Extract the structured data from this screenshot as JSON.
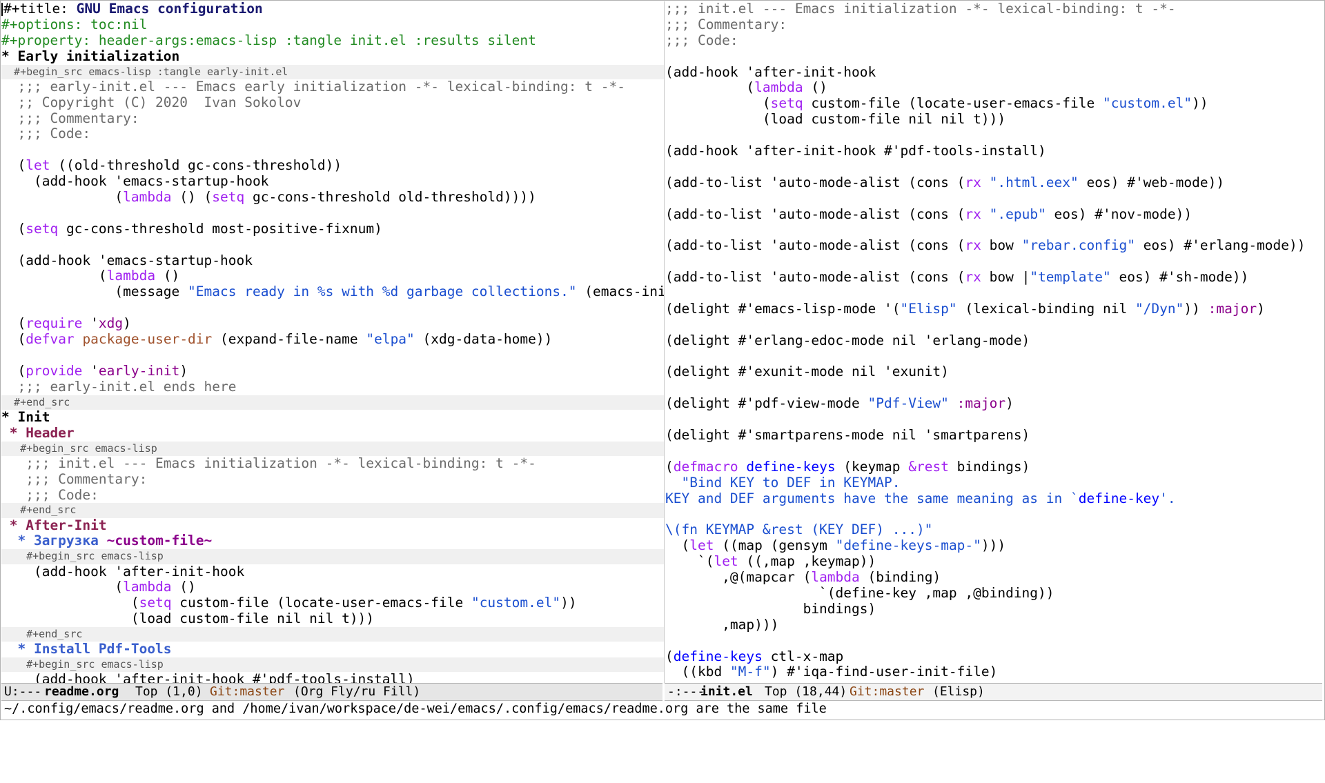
{
  "left_buffer": {
    "lines": [
      {
        "cls": "",
        "segs": [
          [
            "kw-title",
            "#+title: "
          ],
          [
            "t-title",
            "GNU Emacs configuration"
          ]
        ],
        "cursor": true
      },
      {
        "cls": "meta",
        "segs": [
          [
            "meta",
            "#+options: toc:nil"
          ]
        ]
      },
      {
        "cls": "meta",
        "segs": [
          [
            "meta",
            "#+property: header-args:emacs-lisp :tangle init.el :results silent"
          ]
        ]
      },
      {
        "cls": "h1",
        "segs": [
          [
            "",
            "* Early initialization"
          ]
        ]
      },
      {
        "cls": "small",
        "segs": [
          [
            "",
            "  #+begin_src emacs-lisp :tangle early-init.el"
          ]
        ]
      },
      {
        "cls": "",
        "segs": [
          [
            "cm",
            "  ;;; early-init.el --- Emacs early initialization -*- lexical-binding: t -*-"
          ]
        ]
      },
      {
        "cls": "",
        "segs": [
          [
            "cm",
            "  ;; Copyright (C) 2020  Ivan Sokolov"
          ]
        ]
      },
      {
        "cls": "",
        "segs": [
          [
            "cm",
            "  ;;; Commentary:"
          ]
        ]
      },
      {
        "cls": "",
        "segs": [
          [
            "cm",
            "  ;;; Code:"
          ]
        ]
      },
      {
        "cls": "",
        "segs": [
          [
            "",
            ""
          ]
        ]
      },
      {
        "cls": "",
        "segs": [
          [
            "",
            "  ("
          ],
          [
            "kw",
            "let"
          ],
          [
            "",
            " ((old-threshold gc-cons-threshold))"
          ]
        ]
      },
      {
        "cls": "",
        "segs": [
          [
            "",
            "    (add-hook 'emacs-startup-hook"
          ]
        ]
      },
      {
        "cls": "",
        "segs": [
          [
            "",
            "              ("
          ],
          [
            "kw",
            "lambda"
          ],
          [
            "",
            " () ("
          ],
          [
            "kw",
            "setq"
          ],
          [
            "",
            " gc-cons-threshold old-threshold))))"
          ]
        ]
      },
      {
        "cls": "",
        "segs": [
          [
            "",
            ""
          ]
        ]
      },
      {
        "cls": "",
        "segs": [
          [
            "",
            "  ("
          ],
          [
            "kw",
            "setq"
          ],
          [
            "",
            " gc-cons-threshold most-positive-fixnum)"
          ]
        ]
      },
      {
        "cls": "",
        "segs": [
          [
            "",
            ""
          ]
        ]
      },
      {
        "cls": "",
        "segs": [
          [
            "",
            "  (add-hook 'emacs-startup-hook"
          ]
        ]
      },
      {
        "cls": "",
        "segs": [
          [
            "",
            "            ("
          ],
          [
            "kw",
            "lambda"
          ],
          [
            "",
            " ()"
          ]
        ]
      },
      {
        "cls": "",
        "segs": [
          [
            "",
            "              (message "
          ],
          [
            "str",
            "\"Emacs ready in %s with %d garbage collections.\""
          ],
          [
            "",
            " (emacs-init-ti"
          ]
        ]
      },
      {
        "cls": "",
        "segs": [
          [
            "",
            ""
          ]
        ]
      },
      {
        "cls": "",
        "segs": [
          [
            "",
            "  ("
          ],
          [
            "kw",
            "require"
          ],
          [
            "",
            " '"
          ],
          [
            "kwd",
            "xdg"
          ],
          [
            "",
            ")"
          ]
        ]
      },
      {
        "cls": "",
        "segs": [
          [
            "",
            "  ("
          ],
          [
            "kw",
            "defvar"
          ],
          [
            "",
            " "
          ],
          [
            "var",
            "package-user-dir"
          ],
          [
            "",
            " (expand-file-name "
          ],
          [
            "str",
            "\"elpa\""
          ],
          [
            "",
            " (xdg-data-home))"
          ]
        ]
      },
      {
        "cls": "",
        "segs": [
          [
            "",
            ""
          ]
        ]
      },
      {
        "cls": "",
        "segs": [
          [
            "",
            "  ("
          ],
          [
            "kw",
            "provide"
          ],
          [
            "",
            " '"
          ],
          [
            "kwd",
            "early-init"
          ],
          [
            "",
            ")"
          ]
        ]
      },
      {
        "cls": "",
        "segs": [
          [
            "cm",
            "  ;;; early-init.el ends here"
          ]
        ]
      },
      {
        "cls": "small",
        "segs": [
          [
            "",
            "  #+end_src"
          ]
        ]
      },
      {
        "cls": "h1",
        "segs": [
          [
            "",
            "* Init"
          ]
        ]
      },
      {
        "cls": "h2",
        "segs": [
          [
            "",
            " * Header"
          ]
        ]
      },
      {
        "cls": "small",
        "segs": [
          [
            "",
            "   #+begin_src emacs-lisp"
          ]
        ]
      },
      {
        "cls": "",
        "segs": [
          [
            "cm",
            "   ;;; init.el --- Emacs initialization -*- lexical-binding: t -*-"
          ]
        ]
      },
      {
        "cls": "",
        "segs": [
          [
            "cm",
            "   ;;; Commentary:"
          ]
        ]
      },
      {
        "cls": "",
        "segs": [
          [
            "cm",
            "   ;;; Code:"
          ]
        ]
      },
      {
        "cls": "small",
        "segs": [
          [
            "",
            "   #+end_src"
          ]
        ]
      },
      {
        "cls": "h2",
        "segs": [
          [
            "",
            " * After-Init"
          ]
        ]
      },
      {
        "cls": "h3",
        "segs": [
          [
            "",
            "  * Загрузка "
          ],
          [
            "kwd",
            "~custom-file~"
          ]
        ]
      },
      {
        "cls": "small",
        "segs": [
          [
            "",
            "    #+begin_src emacs-lisp"
          ]
        ]
      },
      {
        "cls": "",
        "segs": [
          [
            "",
            "    (add-hook 'after-init-hook"
          ]
        ]
      },
      {
        "cls": "",
        "segs": [
          [
            "",
            "              ("
          ],
          [
            "kw",
            "lambda"
          ],
          [
            "",
            " ()"
          ]
        ]
      },
      {
        "cls": "",
        "segs": [
          [
            "",
            "                ("
          ],
          [
            "kw",
            "setq"
          ],
          [
            "",
            " custom-file (locate-user-emacs-file "
          ],
          [
            "str",
            "\"custom.el\""
          ],
          [
            "",
            "))"
          ]
        ]
      },
      {
        "cls": "",
        "segs": [
          [
            "",
            "                (load custom-file nil nil t)))"
          ]
        ]
      },
      {
        "cls": "small",
        "segs": [
          [
            "",
            "    #+end_src"
          ]
        ]
      },
      {
        "cls": "h3",
        "segs": [
          [
            "",
            "  * Install Pdf-Tools"
          ]
        ]
      },
      {
        "cls": "small",
        "segs": [
          [
            "",
            "    #+begin_src emacs-lisp"
          ]
        ]
      },
      {
        "cls": "",
        "segs": [
          [
            "",
            "    (add-hook 'after-init-hook #'pdf-tools-install)"
          ]
        ]
      }
    ]
  },
  "right_buffer": {
    "lines": [
      {
        "cls": "",
        "segs": [
          [
            "cm",
            ";;; init.el --- Emacs initialization -*- lexical-binding: t -*-"
          ]
        ]
      },
      {
        "cls": "",
        "segs": [
          [
            "cm",
            ";;; Commentary:"
          ]
        ]
      },
      {
        "cls": "",
        "segs": [
          [
            "cm",
            ";;; Code:"
          ]
        ]
      },
      {
        "cls": "",
        "segs": [
          [
            "",
            ""
          ]
        ]
      },
      {
        "cls": "",
        "segs": [
          [
            "",
            "(add-hook 'after-init-hook"
          ]
        ]
      },
      {
        "cls": "",
        "segs": [
          [
            "",
            "          ("
          ],
          [
            "kw",
            "lambda"
          ],
          [
            "",
            " ()"
          ]
        ]
      },
      {
        "cls": "",
        "segs": [
          [
            "",
            "            ("
          ],
          [
            "kw",
            "setq"
          ],
          [
            "",
            " custom-file (locate-user-emacs-file "
          ],
          [
            "str",
            "\"custom.el\""
          ],
          [
            "",
            "))"
          ]
        ]
      },
      {
        "cls": "",
        "segs": [
          [
            "",
            "            (load custom-file nil nil t)))"
          ]
        ]
      },
      {
        "cls": "",
        "segs": [
          [
            "",
            ""
          ]
        ]
      },
      {
        "cls": "",
        "segs": [
          [
            "",
            "(add-hook 'after-init-hook #'pdf-tools-install)"
          ]
        ]
      },
      {
        "cls": "",
        "segs": [
          [
            "",
            ""
          ]
        ]
      },
      {
        "cls": "",
        "segs": [
          [
            "",
            "(add-to-list 'auto-mode-alist (cons ("
          ],
          [
            "kw",
            "rx"
          ],
          [
            "",
            " "
          ],
          [
            "str",
            "\".html.eex\""
          ],
          [
            "",
            " eos) #'web-mode))"
          ]
        ]
      },
      {
        "cls": "",
        "segs": [
          [
            "",
            ""
          ]
        ]
      },
      {
        "cls": "",
        "segs": [
          [
            "",
            "(add-to-list 'auto-mode-alist (cons ("
          ],
          [
            "kw",
            "rx"
          ],
          [
            "",
            " "
          ],
          [
            "str",
            "\".epub\""
          ],
          [
            "",
            " eos) #'nov-mode))"
          ]
        ]
      },
      {
        "cls": "",
        "segs": [
          [
            "",
            ""
          ]
        ]
      },
      {
        "cls": "",
        "segs": [
          [
            "",
            "(add-to-list 'auto-mode-alist (cons ("
          ],
          [
            "kw",
            "rx"
          ],
          [
            "",
            " bow "
          ],
          [
            "str",
            "\"rebar.config\""
          ],
          [
            "",
            " eos) #'erlang-mode))"
          ]
        ]
      },
      {
        "cls": "",
        "segs": [
          [
            "",
            ""
          ]
        ]
      },
      {
        "cls": "",
        "segs": [
          [
            "",
            "(add-to-list 'auto-mode-alist (cons ("
          ],
          [
            "kw",
            "rx"
          ],
          [
            "",
            " bow |"
          ],
          [
            "str",
            "\"template\""
          ],
          [
            "",
            " eos) #'sh-mode))"
          ]
        ]
      },
      {
        "cls": "",
        "segs": [
          [
            "",
            ""
          ]
        ]
      },
      {
        "cls": "",
        "segs": [
          [
            "",
            "(delight #'emacs-lisp-mode '("
          ],
          [
            "str",
            "\"Elisp\""
          ],
          [
            "",
            " (lexical-binding nil "
          ],
          [
            "str",
            "\"/Dyn\""
          ],
          [
            "",
            ")) "
          ],
          [
            "kwd",
            ":major"
          ],
          [
            "",
            ")"
          ]
        ]
      },
      {
        "cls": "",
        "segs": [
          [
            "",
            ""
          ]
        ]
      },
      {
        "cls": "",
        "segs": [
          [
            "",
            "(delight #'erlang-edoc-mode nil 'erlang-mode)"
          ]
        ]
      },
      {
        "cls": "",
        "segs": [
          [
            "",
            ""
          ]
        ]
      },
      {
        "cls": "",
        "segs": [
          [
            "",
            "(delight #'exunit-mode nil 'exunit)"
          ]
        ]
      },
      {
        "cls": "",
        "segs": [
          [
            "",
            ""
          ]
        ]
      },
      {
        "cls": "",
        "segs": [
          [
            "",
            "(delight #'pdf-view-mode "
          ],
          [
            "str",
            "\"Pdf-View\""
          ],
          [
            "",
            " "
          ],
          [
            "kwd",
            ":major"
          ],
          [
            "",
            ")"
          ]
        ]
      },
      {
        "cls": "",
        "segs": [
          [
            "",
            ""
          ]
        ]
      },
      {
        "cls": "",
        "segs": [
          [
            "",
            "(delight #'smartparens-mode nil 'smartparens)"
          ]
        ]
      },
      {
        "cls": "",
        "segs": [
          [
            "",
            ""
          ]
        ]
      },
      {
        "cls": "",
        "segs": [
          [
            "",
            "("
          ],
          [
            "kw",
            "defmacro"
          ],
          [
            "",
            " "
          ],
          [
            "fn",
            "define-keys"
          ],
          [
            "",
            " (keymap "
          ],
          [
            "kw",
            "&rest"
          ],
          [
            "",
            " bindings)"
          ]
        ]
      },
      {
        "cls": "",
        "segs": [
          [
            "str",
            "  \"Bind KEY to DEF in KEYMAP."
          ]
        ]
      },
      {
        "cls": "",
        "segs": [
          [
            "str",
            "KEY and DEF arguments have the same meaning as in `"
          ],
          [
            "fn",
            "define-key"
          ],
          [
            "str",
            "'."
          ]
        ]
      },
      {
        "cls": "",
        "segs": [
          [
            "",
            ""
          ]
        ]
      },
      {
        "cls": "",
        "segs": [
          [
            "str",
            "\\(fn KEYMAP &rest (KEY DEF) ...)\""
          ]
        ]
      },
      {
        "cls": "",
        "segs": [
          [
            "",
            "  ("
          ],
          [
            "kw",
            "let"
          ],
          [
            "",
            " ((map (gensym "
          ],
          [
            "str",
            "\"define-keys-map-\""
          ],
          [
            "",
            ")))"
          ]
        ]
      },
      {
        "cls": "",
        "segs": [
          [
            "",
            "    `("
          ],
          [
            "kw",
            "let"
          ],
          [
            "",
            " ((,map ,keymap))"
          ]
        ]
      },
      {
        "cls": "",
        "segs": [
          [
            "",
            "       ,@(mapcar ("
          ],
          [
            "kw",
            "lambda"
          ],
          [
            "",
            " (binding)"
          ]
        ]
      },
      {
        "cls": "",
        "segs": [
          [
            "",
            "                   `(define-key ,map ,@binding))"
          ]
        ]
      },
      {
        "cls": "",
        "segs": [
          [
            "",
            "                 bindings)"
          ]
        ]
      },
      {
        "cls": "",
        "segs": [
          [
            "",
            "       ,map)))"
          ]
        ]
      },
      {
        "cls": "",
        "segs": [
          [
            "",
            ""
          ]
        ]
      },
      {
        "cls": "",
        "segs": [
          [
            "",
            "("
          ],
          [
            "fn",
            "define-keys"
          ],
          [
            "",
            " ctl-x-map"
          ]
        ]
      },
      {
        "cls": "",
        "segs": [
          [
            "",
            "  ((kbd "
          ],
          [
            "str",
            "\"M-f\""
          ],
          [
            "",
            ") #'iqa-find-user-init-file)"
          ]
        ]
      }
    ]
  },
  "modeline_left": {
    "status": "U:---",
    "buffer": "readme.org",
    "position": "Top (1,0)",
    "vc": "Git:master",
    "modes": "(Org Fly/ru Fill)"
  },
  "modeline_right": {
    "status": "-:---",
    "buffer": "init.el",
    "position": "Top (18,44)",
    "vc": "Git:master",
    "modes": "(Elisp)"
  },
  "echo_area": {
    "message": "~/.config/emacs/readme.org and /home/ivan/workspace/de-wei/emacs/.config/emacs/readme.org are the same file"
  },
  "colors": {
    "keyword": "#a020f0",
    "string": "#1b4fd0",
    "comment": "#6b6b6b",
    "org_meta": "#228b22",
    "heading2": "#8b2252",
    "heading3": "#3a5fcd"
  }
}
